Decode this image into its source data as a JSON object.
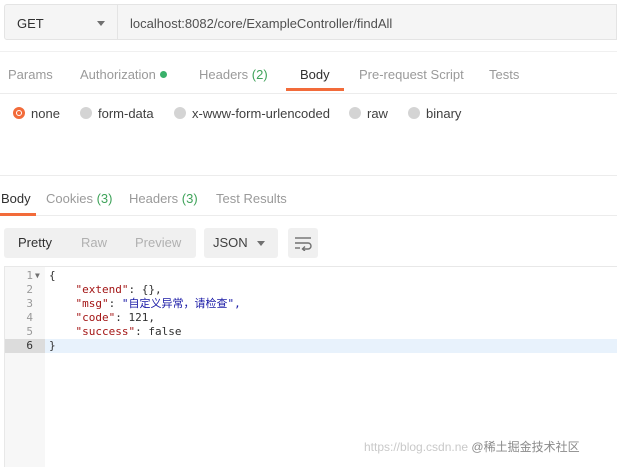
{
  "request": {
    "method": "GET",
    "url": "localhost:8082/core/ExampleController/findAll"
  },
  "request_tabs": [
    {
      "label": "Params"
    },
    {
      "label": "Authorization"
    },
    {
      "label": "Headers",
      "count": "(2)"
    },
    {
      "label": "Body"
    },
    {
      "label": "Pre-request Script"
    },
    {
      "label": "Tests"
    }
  ],
  "body_types": [
    {
      "label": "none",
      "selected": true
    },
    {
      "label": "form-data"
    },
    {
      "label": "x-www-form-urlencoded"
    },
    {
      "label": "raw"
    },
    {
      "label": "binary"
    }
  ],
  "response_tabs": [
    {
      "label": "Body"
    },
    {
      "label": "Cookies",
      "count": "(3)"
    },
    {
      "label": "Headers",
      "count": "(3)"
    },
    {
      "label": "Test Results"
    }
  ],
  "view_modes": [
    "Pretty",
    "Raw",
    "Preview"
  ],
  "format": "JSON",
  "code": {
    "line_numbers": [
      "1",
      "2",
      "3",
      "4",
      "5",
      "6"
    ],
    "open_brace": "{",
    "close_brace": "}",
    "extend_key": "\"extend\"",
    "extend_val": "{},",
    "msg_key": "\"msg\"",
    "msg_val": "\"自定义异常，请检查\",",
    "code_key": "\"code\"",
    "code_val": "121,",
    "success_key": "\"success\"",
    "success_val": "false"
  },
  "watermark": {
    "url": "https://blog.csdn.ne",
    "site": "@稀土掘金技术社区"
  },
  "colors": {
    "accent": "#f26b3a",
    "count_green": "#3fa35a"
  }
}
